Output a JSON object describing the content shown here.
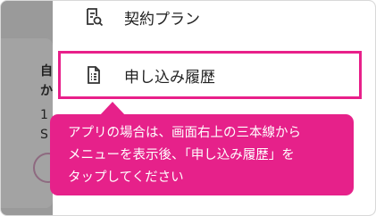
{
  "menu": {
    "items": [
      {
        "label": "契約プラン",
        "icon": "contract-search-icon"
      },
      {
        "label": "申し込み履歴",
        "icon": "document-list-icon"
      }
    ]
  },
  "callout": {
    "text": "アプリの場合は、画面右上の三本線から\nメニューを表示後、「申し込み履歴」を\nタップしてください"
  },
  "background": {
    "line1": "自",
    "line2": "か",
    "line3": "1",
    "line4": "S"
  },
  "colors": {
    "highlight": "#e8208a",
    "callout": "#e6218a",
    "overlay": "#9a9a9a"
  }
}
